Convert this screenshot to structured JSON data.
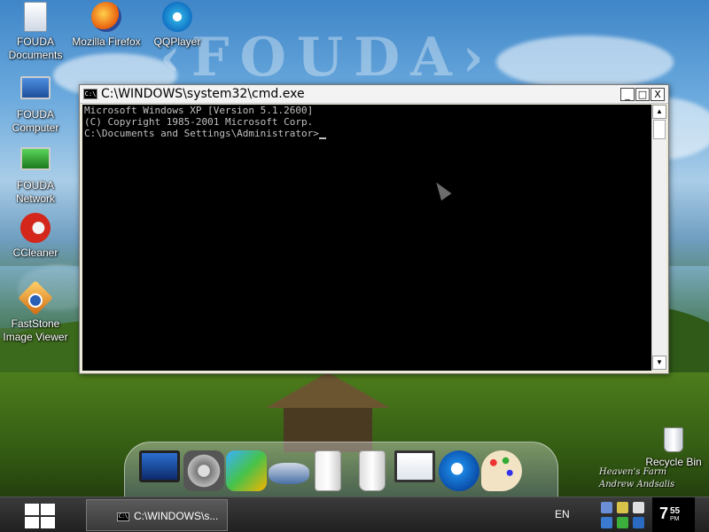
{
  "desktop": {
    "icons": [
      {
        "label": "FOUDA\nDocuments"
      },
      {
        "label": "Mozilla Firefox"
      },
      {
        "label": "QQPlayer"
      },
      {
        "label": "FOUDA\nComputer"
      },
      {
        "label": "FOUDA\nNetwork"
      },
      {
        "label": "CCleaner"
      },
      {
        "label": "FastStone\nImage Viewer"
      },
      {
        "label": "Recycle Bin"
      }
    ],
    "signature": {
      "line1": "Heaven's Farm",
      "line2": "Andrew Andsalis"
    }
  },
  "cmd": {
    "title": "C:\\WINDOWS\\system32\\cmd.exe",
    "app_icon_text": "C:\\",
    "lines": [
      "Microsoft Windows XP [Version 5.1.2600]",
      "(C) Copyright 1985-2001 Microsoft Corp.",
      "",
      "C:\\Documents and Settings\\Administrator>"
    ],
    "buttons": {
      "minimize": "_",
      "maximize": "□",
      "close": "X"
    }
  },
  "taskbar": {
    "task_label": "C:\\WINDOWS\\s...",
    "task_icon_text": "C:\\",
    "language": "EN",
    "clock": {
      "hour": "7",
      "minute": "55",
      "ampm": "PM"
    }
  },
  "colors": {
    "taskbar": "#2b2b2b",
    "console_bg": "#000000",
    "console_fg": "#c0c0c0"
  },
  "icons_semantic": [
    "documents-icon",
    "firefox-icon",
    "qqplayer-icon",
    "computer-icon",
    "network-icon",
    "ccleaner-icon",
    "faststone-icon",
    "recycle-bin-icon",
    "windows-start-icon",
    "cmd-app-icon"
  ]
}
